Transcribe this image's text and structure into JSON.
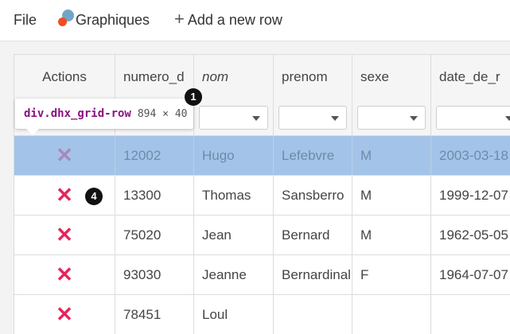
{
  "toolbar": {
    "file_label": "File",
    "graphiques_label": "Graphiques",
    "graphiques_icon": "chart-bubbles-icon",
    "add_row_label": "Add a new row",
    "add_row_icon": "plus-icon"
  },
  "grid": {
    "headers": [
      "Actions",
      "numero_d",
      "nom",
      "prenom",
      "sexe",
      "date_de_r"
    ],
    "rows": [
      {
        "numero": "12002",
        "nom": "Hugo",
        "prenom": "Lefebvre",
        "sexe": "M",
        "date": "2003-03-18",
        "selected": true
      },
      {
        "numero": "13300",
        "nom": "Thomas",
        "prenom": "Sansberro",
        "sexe": "M",
        "date": "1999-12-07"
      },
      {
        "numero": "75020",
        "nom": "Jean",
        "prenom": "Bernard",
        "sexe": "M",
        "date": "1962-05-05"
      },
      {
        "numero": "93030",
        "nom": "Jeanne",
        "prenom": "Bernardinal",
        "sexe": "F",
        "date": "1964-07-07"
      },
      {
        "numero": "78451",
        "nom": "Loul",
        "prenom": "",
        "sexe": "",
        "date": ""
      }
    ],
    "delete_icon": "close-x-icon",
    "colors": {
      "selected_row": "#a3c4e8",
      "delete_x": "#e8245c"
    }
  },
  "tooltip": {
    "selector": "div.dhx_grid-row",
    "dimensions": "894 × 40"
  },
  "badges": [
    "1",
    "4"
  ]
}
